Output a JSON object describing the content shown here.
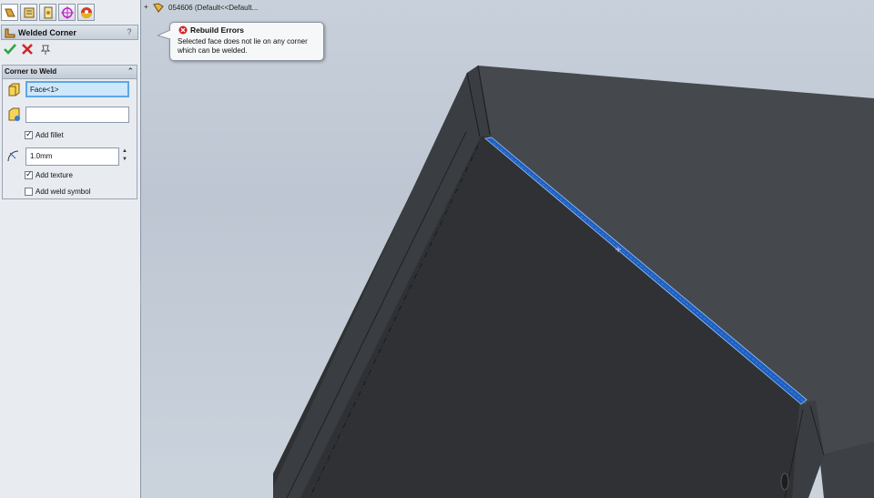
{
  "tree": {
    "expand": "+",
    "label": "054606  (Default<<Default..."
  },
  "property_manager": {
    "title": "Welded Corner",
    "help": "?",
    "tabs": [
      "feature-manager-icon",
      "property-manager-icon",
      "configuration-manager-icon",
      "dim-xpert-icon",
      "display-manager-icon"
    ],
    "actions": {
      "ok": "ok-check-icon",
      "cancel": "cancel-x-icon",
      "pushpin": "pushpin-icon"
    },
    "group": {
      "title": "Corner to Weld",
      "collapse": "«",
      "face_selection": "Face<1>",
      "stopping_selection": "",
      "add_fillet": {
        "label": "Add fillet",
        "checked": true
      },
      "fillet_radius": "1.0mm",
      "add_texture": {
        "label": "Add texture",
        "checked": true
      },
      "add_weld_symbol": {
        "label": "Add weld symbol",
        "checked": false
      }
    }
  },
  "tooltip": {
    "title": "Rebuild Errors",
    "message": "Selected face does not lie on any corner which can be welded."
  },
  "colors": {
    "selection_edge": "#1f5fbf",
    "model_dark": "#2e3033",
    "model_top": "#4a4d51",
    "viewport_bg": "#c4ccd7"
  }
}
